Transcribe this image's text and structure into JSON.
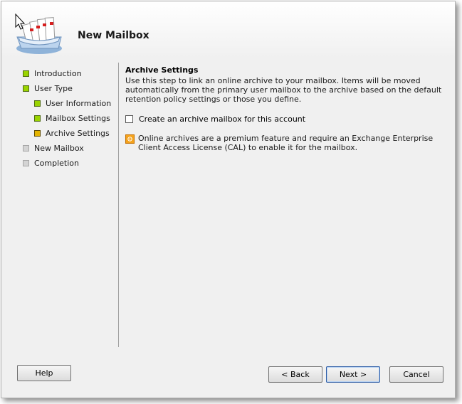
{
  "header": {
    "title": "New Mailbox"
  },
  "nav": {
    "items": [
      {
        "label": "Introduction",
        "state": "done"
      },
      {
        "label": "User Type",
        "state": "done"
      },
      {
        "label": "User Information",
        "state": "done"
      },
      {
        "label": "Mailbox Settings",
        "state": "done"
      },
      {
        "label": "Archive Settings",
        "state": "current"
      },
      {
        "label": "New Mailbox",
        "state": "pending"
      },
      {
        "label": "Completion",
        "state": "pending"
      }
    ]
  },
  "content": {
    "title": "Archive Settings",
    "description": "Use this step to link an online archive to your mailbox. Items will be moved automatically from the primary user mailbox to the archive based on the default retention policy settings or those you define.",
    "checkbox_label": "Create an archive mailbox for this account",
    "checkbox_checked": false,
    "info_text": "Online archives are a premium feature and require an Exchange Enterprise Client Access License (CAL) to enable it for the mailbox."
  },
  "footer": {
    "help": "Help",
    "back": "< Back",
    "next": "Next >",
    "cancel": "Cancel"
  },
  "colors": {
    "bullet_done": "#9ad400",
    "bullet_current": "#e4b400",
    "bullet_pending": "#d4d4d4",
    "info_icon": "#f4a21b"
  }
}
